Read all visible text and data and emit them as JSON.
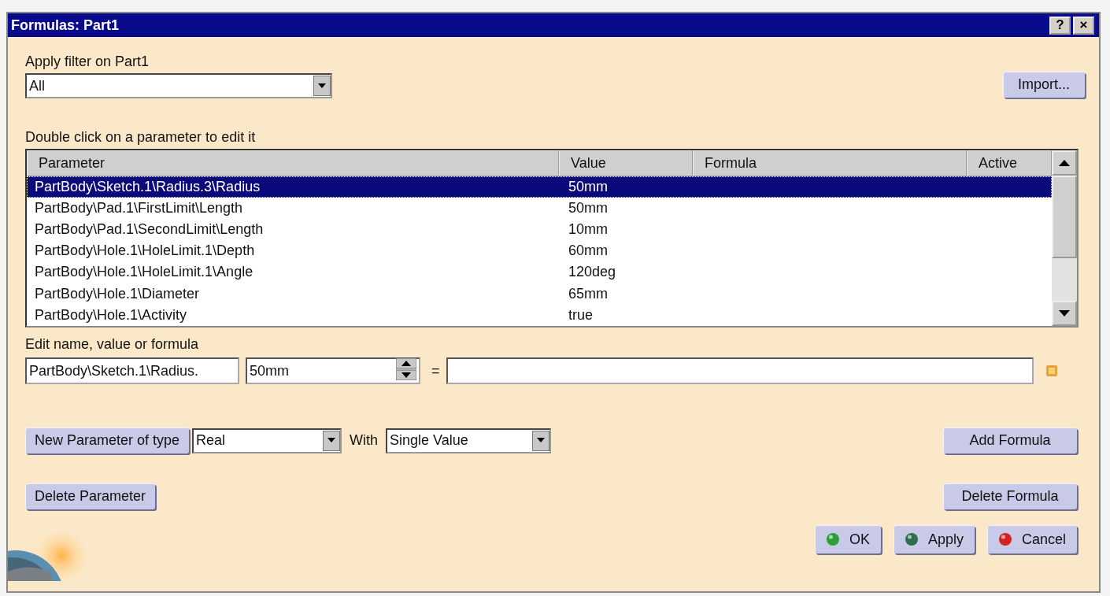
{
  "window": {
    "title": "Formulas: Part1",
    "controls": [
      "?",
      "×"
    ]
  },
  "filter": {
    "label": "Apply filter on Part1",
    "value": "All"
  },
  "import_button": "Import...",
  "table": {
    "caption": "Double click on a parameter to edit it",
    "columns": [
      "Parameter",
      "Value",
      "Formula",
      "Active"
    ],
    "rows": [
      {
        "parameter": "PartBody\\Sketch.1\\Radius.3\\Radius",
        "value": "50mm",
        "selected": true
      },
      {
        "parameter": "PartBody\\Pad.1\\FirstLimit\\Length",
        "value": "50mm",
        "selected": false
      },
      {
        "parameter": "PartBody\\Pad.1\\SecondLimit\\Length",
        "value": "10mm",
        "selected": false
      },
      {
        "parameter": "PartBody\\Hole.1\\HoleLimit.1\\Depth",
        "value": "60mm",
        "selected": false
      },
      {
        "parameter": "PartBody\\Hole.1\\HoleLimit.1\\Angle",
        "value": "120deg",
        "selected": false
      },
      {
        "parameter": "PartBody\\Hole.1\\Diameter",
        "value": "65mm",
        "selected": false
      },
      {
        "parameter": "PartBody\\Hole.1\\Activity",
        "value": "true",
        "selected": false
      }
    ]
  },
  "edit": {
    "label": "Edit name, value or formula",
    "name": "PartBody\\Sketch.1\\Radius.",
    "value": "50mm",
    "equals": "="
  },
  "new_parameter": {
    "button": "New Parameter of type",
    "type": "Real",
    "with_label": "With",
    "multiplicity": "Single Value"
  },
  "add_formula": "Add Formula",
  "delete_parameter": "Delete Parameter",
  "delete_formula": "Delete Formula",
  "dialog_buttons": [
    {
      "label": "OK",
      "color": "#2e9e3a"
    },
    {
      "label": "Apply",
      "color": "#2d6e4e"
    },
    {
      "label": "Cancel",
      "color": "#d42020"
    }
  ]
}
